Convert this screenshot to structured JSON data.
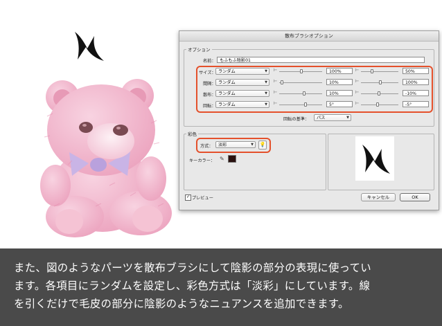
{
  "dialog": {
    "title": "散布ブラシオプション",
    "options_group": "オプション",
    "name_label": "名前：",
    "name_value": "もふもふ陰影01",
    "rows": [
      {
        "label": "サイズ：",
        "method": "ランダム",
        "min": "100%",
        "max": "50%"
      },
      {
        "label": "間隔：",
        "method": "ランダム",
        "min": "10%",
        "max": "100%"
      },
      {
        "label": "散布：",
        "method": "ランダム",
        "min": "10%",
        "max": "-10%"
      },
      {
        "label": "回転：",
        "method": "ランダム",
        "min": "5°",
        "max": "-5°"
      }
    ],
    "rotation_base_label": "回転の基準：",
    "rotation_base_value": "パス",
    "color_group": "彩色",
    "method_label": "方式：",
    "method_value": "淡彩",
    "key_color_label": "キーカラー：",
    "key_color": "#2a1210",
    "preview_label": "プレビュー",
    "cancel_label": "キャンセル",
    "ok_label": "OK"
  },
  "caption": {
    "line1": "また、図のようなパーツを散布ブラシにして陰影の部分の表現に使ってい",
    "line2": "ます。各項目にランダムを設定し、彩色方式は「淡彩」にしています。線",
    "line3": "を引くだけで毛皮の部分に陰影のようなニュアンスを追加できます。"
  },
  "colors": {
    "highlight": "#e4502b",
    "caption_bg": "#4a4a4a",
    "bear_pink": "#f2b6cc"
  },
  "icons": [
    "zigzag-brush-icon",
    "teddy-bear-illustration",
    "eyedropper-icon",
    "info-bulb-icon",
    "checkbox-icon"
  ]
}
